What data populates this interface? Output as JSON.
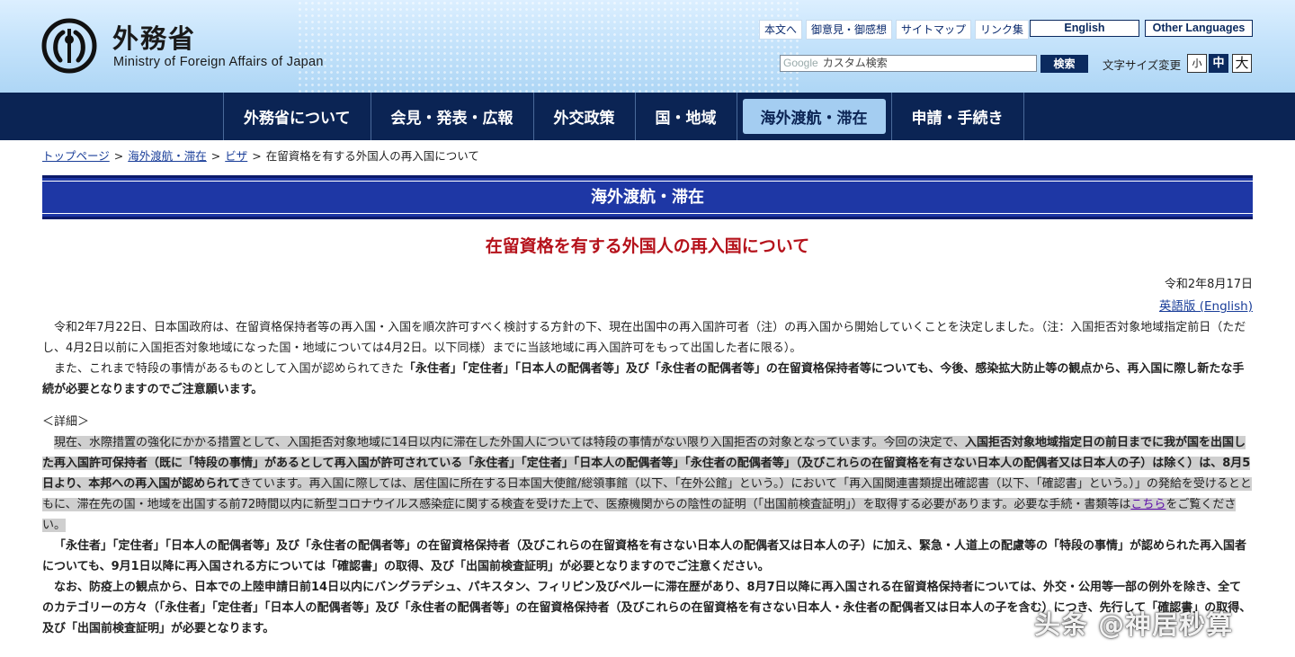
{
  "header": {
    "logo_ja": "外務省",
    "logo_en": "Ministry of Foreign Affairs of Japan",
    "util_links": [
      "本文へ",
      "御意見・御感想",
      "サイトマップ",
      "リンク集"
    ],
    "lang_english": "English",
    "lang_other": "Other Languages",
    "search_google": "Google",
    "search_placeholder": "カスタム検索",
    "search_button": "検索",
    "fontsize_label": "文字サイズ変更",
    "fontsize_small": "小",
    "fontsize_mid": "中",
    "fontsize_large": "大"
  },
  "nav": {
    "items": [
      "外務省について",
      "会見・発表・広報",
      "外交政策",
      "国・地域",
      "海外渡航・滞在",
      "申請・手続き"
    ],
    "active_index": 4
  },
  "breadcrumb": {
    "items": [
      "トップページ",
      "海外渡航・滞在",
      "ビザ"
    ],
    "current": "在留資格を有する外国人の再入国について",
    "separator": ">"
  },
  "section_banner": "海外渡航・滞在",
  "page_title": "在留資格を有する外国人の再入国について",
  "date": "令和2年8月17日",
  "english_version_link": "英語版 (English)",
  "body": {
    "p1": "令和2年7月22日、日本国政府は、在留資格保持者等の再入国・入国を順次許可すべく検討する方針の下、現在出国中の再入国許可者（注）の再入国から開始していくことを決定しました。（注：入国拒否対象地域指定前日（ただし、4月2日以前に入国拒否対象地域になった国・地域については4月2日。以下同様）までに当該地域に再入国許可をもって出国した者に限る）。",
    "p2_a": "また、これまで特段の事情があるものとして入国が認められてきた",
    "p2_b": "「永住者」「定住者」「日本人の配偶者等」及び「永住者の配偶者等」の在留資格保持者等についても、今後、感染拡大防止等の観点から、再入国に際し新たな手続が必要となりますのでご注意願います。",
    "detail_heading": "＜詳細＞",
    "p3_a": "現在、水際措置の強化にかかる措置として、入国拒否対象地域に14日以内に滞在した外国人については特段の事情がない限り入国拒否の対象となっています。今回の決定で、",
    "p3_b": "入国拒否対象地域指定日の前日までに我が国を出国した再入国許可保持者（既に「特段の事情」があるとして再入国が許可されている「永住者」「定住者」「日本人の配偶者等」「永住者の配偶者等」（及びこれらの在留資格を有さない日本人の配偶者又は日本人の子）は除く）は、8月5日より、本邦への再入国が認められて",
    "p3_c": "きています。再入国に際しては、居住国に所在する日本国大使館/総領事館（以下、「在外公館」という。）において「再入国関連書類提出確認書（以下、「確認書」という。）」の発給を受けるとともに、滞在先の国・地域を出国する前72時間以内に新型コロナウイルス感染症に関する検査を受けた上で、医療機関からの陰性の証明（「出国前検査証明」）を取得する必要があります。必要な手続・書類等は",
    "p3_link": "こちら",
    "p3_d": "をご覧ください。",
    "p4": "「永住者」「定住者」「日本人の配偶者等」及び「永住者の配偶者等」の在留資格保持者（及びこれらの在留資格を有さない日本人の配偶者又は日本人の子）に加え、緊急・人道上の配慮等の「特段の事情」が認められた再入国者についても、9月1日以降に再入国される方については「確認書」の取得、及び「出国前検査証明」が必要となりますのでご注意ください。",
    "p5_a": "なお、防疫上の観点から、日本での上陸申請日前14日以内にバングラデシュ、パキスタン、フィリピン及びペルーに滞在歴があり、8月7日以降に再入国される在留資格保持者については、外交・公用等一部の例外を除き、全てのカテゴリーの方々（「永住者」「定住者」「日本人の配偶者等」及び「永住者の配偶者等」の在留資格保持者（及びこれらの在留資格を有さない日本人・永住者の配偶者又は日本人の子",
    "p5_b": "を含む）につき、先行して「確認書」の取得、及び「出国前検査証明」が必要となります。"
  },
  "watermark": "头条 @神居秒算",
  "colors": {
    "nav_bg": "#0b2454",
    "banner_bg": "#1e37a5",
    "title_red": "#b5121b",
    "link_blue": "#1a3e99",
    "highlight_gray": "#cfcfcf"
  }
}
